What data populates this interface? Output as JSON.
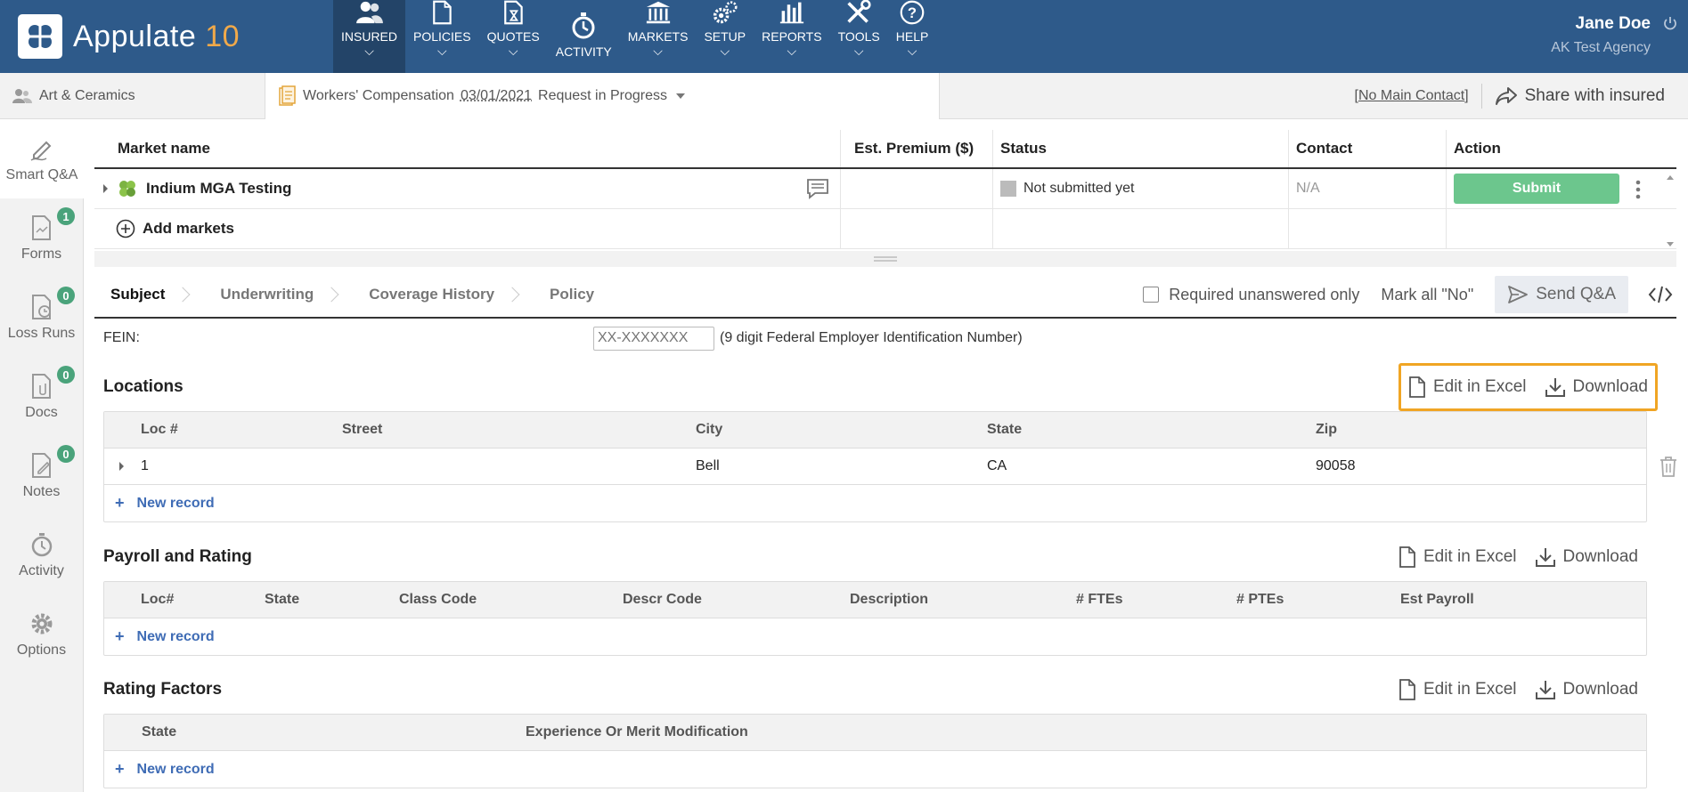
{
  "app": {
    "name": "Appulate",
    "version": "10"
  },
  "nav": [
    {
      "label": "INSURED",
      "icon": "insured-icon",
      "active": true
    },
    {
      "label": "POLICIES",
      "icon": "policies-icon"
    },
    {
      "label": "QUOTES",
      "icon": "quotes-icon"
    },
    {
      "label": "ACTIVITY",
      "icon": "activity-icon"
    },
    {
      "label": "MARKETS",
      "icon": "markets-icon"
    },
    {
      "label": "SETUP",
      "icon": "setup-icon"
    },
    {
      "label": "REPORTS",
      "icon": "reports-icon"
    },
    {
      "label": "TOOLS",
      "icon": "tools-icon"
    },
    {
      "label": "HELP",
      "icon": "help-icon"
    }
  ],
  "user": {
    "name": "Jane Doe",
    "agency": "AK Test Agency"
  },
  "subbar": {
    "insured": "Art & Ceramics",
    "policy_type": "Workers' Compensation",
    "policy_date": "03/01/2021",
    "policy_status": "Request in Progress",
    "contact": "No Main Contact",
    "share": "Share with insured"
  },
  "sidebar": [
    {
      "label": "Smart Q&A",
      "icon": "smart-qa-icon",
      "active": true
    },
    {
      "label": "Forms",
      "icon": "forms-icon",
      "badge": "1"
    },
    {
      "label": "Loss Runs",
      "icon": "loss-runs-icon",
      "badge": "0"
    },
    {
      "label": "Docs",
      "icon": "docs-icon",
      "badge": "0"
    },
    {
      "label": "Notes",
      "icon": "notes-icon",
      "badge": "0"
    },
    {
      "label": "Activity",
      "icon": "activity-icon"
    },
    {
      "label": "Options",
      "icon": "options-icon"
    }
  ],
  "markets": {
    "headers": {
      "name": "Market name",
      "premium": "Est. Premium ($)",
      "status": "Status",
      "contact": "Contact",
      "action": "Action"
    },
    "rows": [
      {
        "name": "Indium MGA Testing",
        "premium": "",
        "status": "Not submitted yet",
        "contact": "N/A",
        "action": "Submit"
      }
    ],
    "add_label": "Add markets"
  },
  "tabs": {
    "items": [
      "Subject",
      "Underwriting",
      "Coverage History",
      "Policy"
    ],
    "active": "Subject",
    "required_only": "Required unanswered only",
    "mark_all_no": "Mark all \"No\"",
    "send_qa": "Send Q&A"
  },
  "fein": {
    "label": "FEIN:",
    "placeholder": "XX-XXXXXXX",
    "value": "",
    "hint": "(9 digit Federal Employer Identification Number)"
  },
  "actions": {
    "edit_excel": "Edit in Excel",
    "download": "Download",
    "new_record": "New record"
  },
  "locations": {
    "title": "Locations",
    "headers": [
      "Loc #",
      "Street",
      "City",
      "State",
      "Zip"
    ],
    "rows": [
      {
        "loc": "1",
        "street": "",
        "city": "Bell",
        "state": "CA",
        "zip": "90058"
      }
    ]
  },
  "payroll": {
    "title": "Payroll and Rating",
    "headers": [
      "Loc#",
      "State",
      "Class Code",
      "Descr Code",
      "Description",
      "# FTEs",
      "# PTEs",
      "Est Payroll"
    ]
  },
  "rating": {
    "title": "Rating Factors",
    "headers": [
      "State",
      "Experience Or Merit Modification"
    ]
  },
  "colors": {
    "topbar": "#2e5a8a",
    "accent_version": "#f0a94a",
    "submit": "#6cc68d",
    "badge": "#4aa37b",
    "highlight": "#f0a524",
    "link": "#3f6cb5"
  }
}
